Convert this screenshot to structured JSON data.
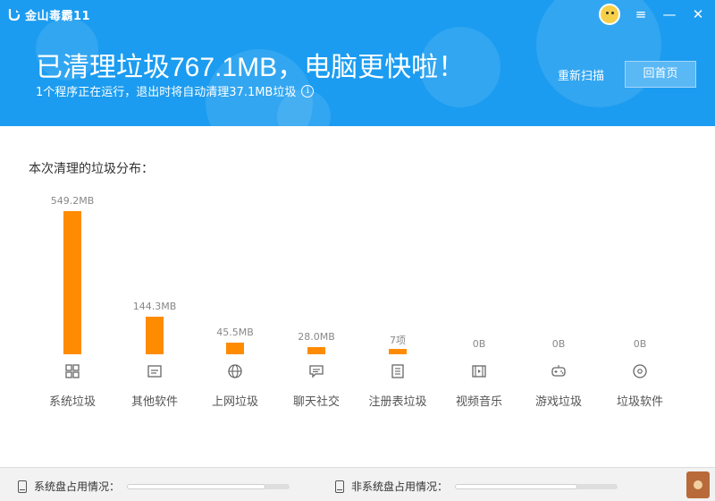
{
  "app": {
    "name": "金山毒霸11"
  },
  "header": {
    "headline": "已清理垃圾767.1MB，电脑更快啦！",
    "subline": "1个程序正在运行，退出时将自动清理37.1MB垃圾",
    "rescan_label": "重新扫描",
    "home_label": "回首页",
    "accent": "#1b9cf0"
  },
  "window_controls": {
    "menu": "≡",
    "minimize": "—",
    "close": "✕"
  },
  "section": {
    "title": "本次清理的垃圾分布："
  },
  "chart_data": {
    "type": "bar",
    "unit": "MB",
    "bar_color": "#ff8b00",
    "categories": [
      "系统垃圾",
      "其他软件",
      "上网垃圾",
      "聊天社交",
      "注册表垃圾",
      "视频音乐",
      "游戏垃圾",
      "垃圾软件"
    ],
    "values": [
      549.2,
      144.3,
      45.5,
      28.0,
      7,
      0,
      0,
      0
    ],
    "value_labels": [
      "549.2MB",
      "144.3MB",
      "45.5MB",
      "28.0MB",
      "7项",
      "0B",
      "0B",
      "0B"
    ],
    "icons": [
      "windows-icon",
      "app-window-icon",
      "globe-icon",
      "chat-icon",
      "registry-list-icon",
      "video-icon",
      "gamepad-icon",
      "disc-icon"
    ]
  },
  "footer": {
    "system_disk_label": "系统盘占用情况：",
    "system_disk_usage": 0.85,
    "other_disk_label": "非系统盘占用情况：",
    "other_disk_usage": 0.75
  }
}
